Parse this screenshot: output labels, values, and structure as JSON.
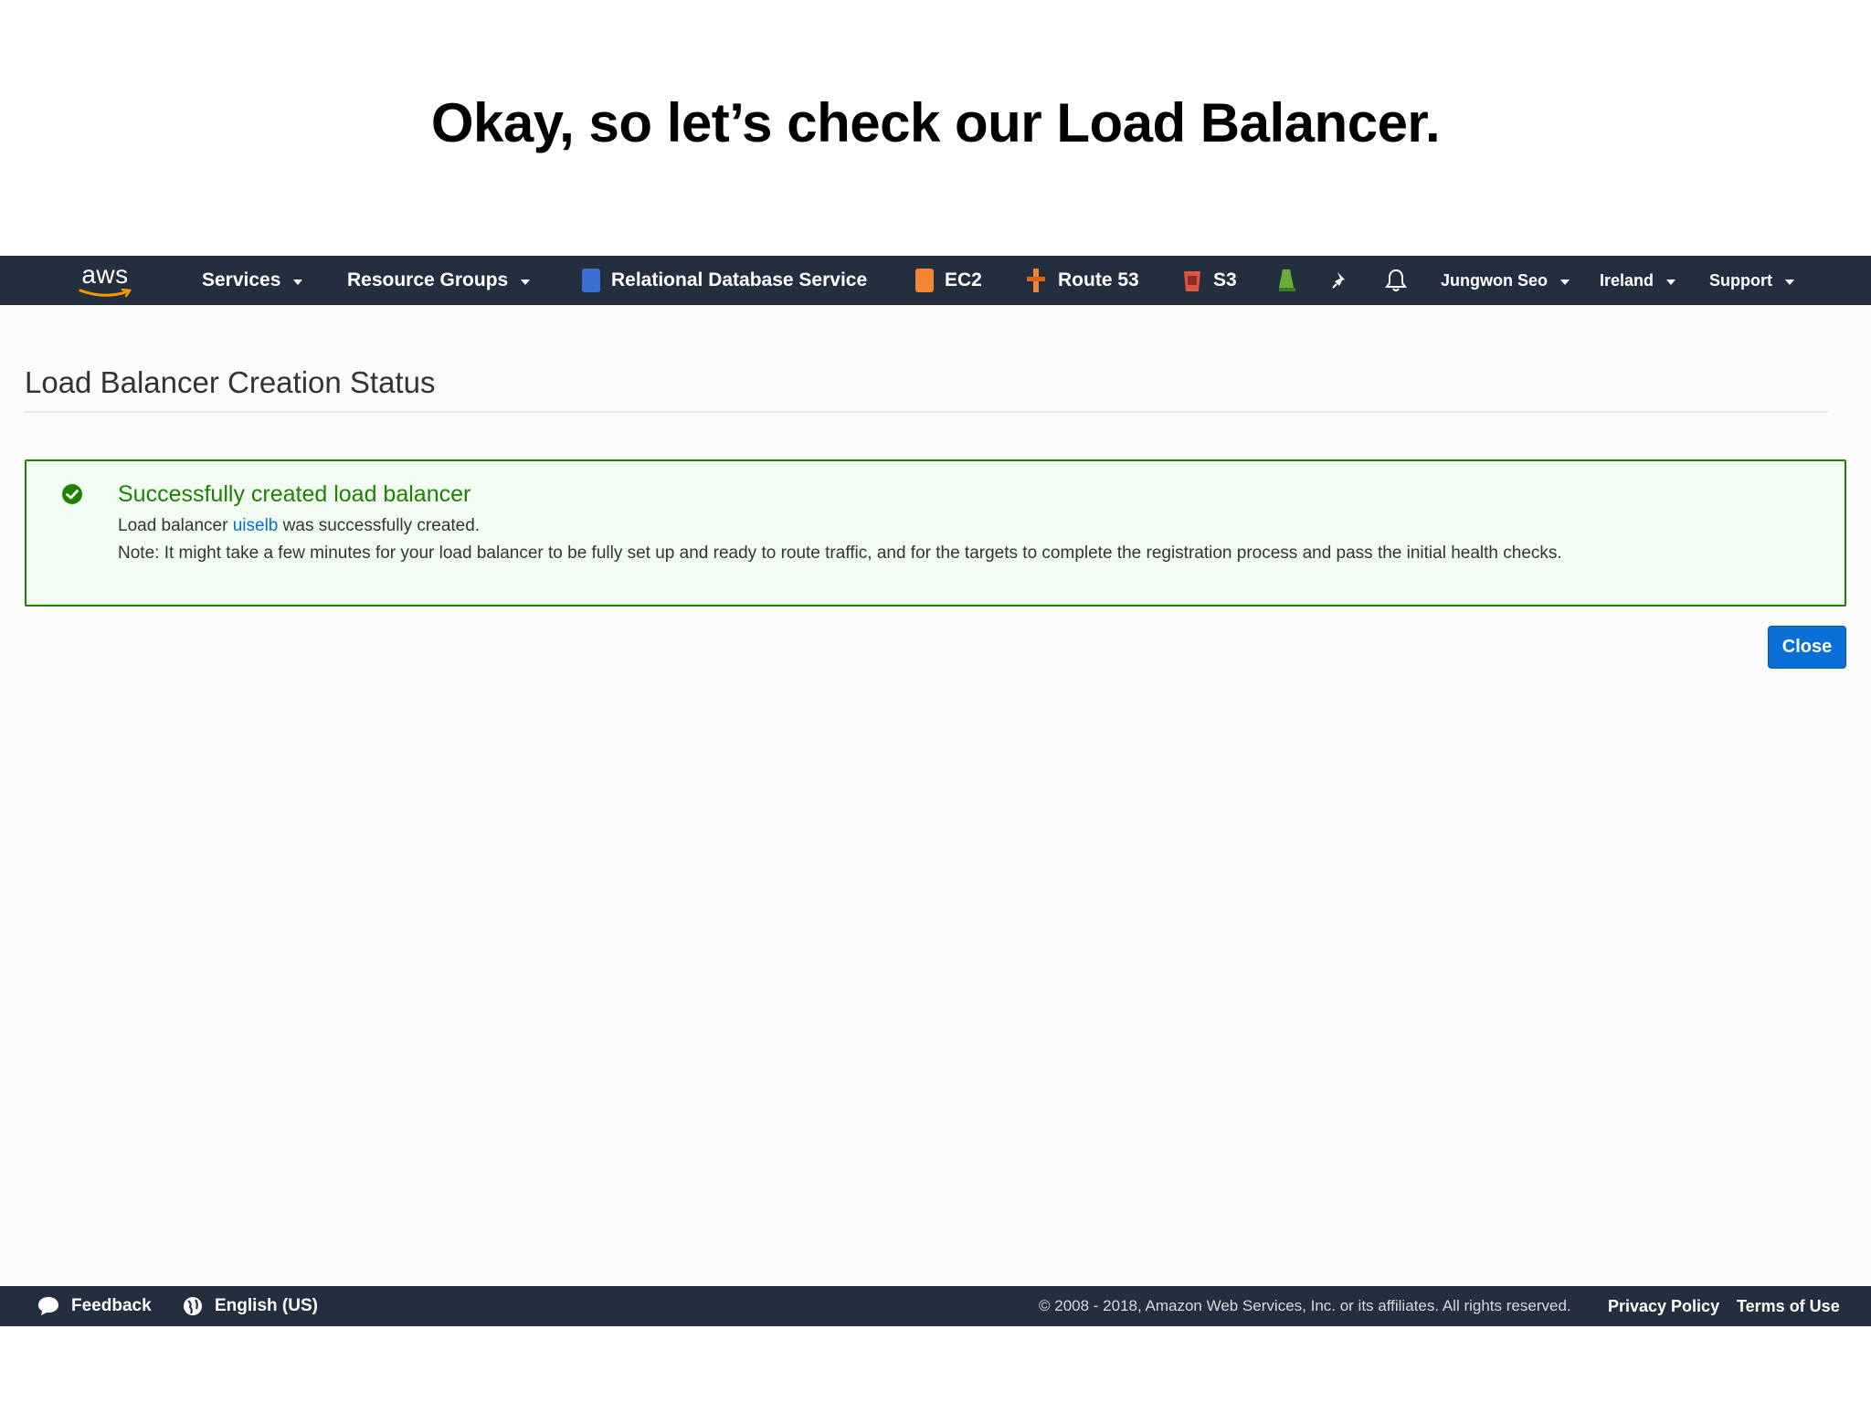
{
  "slide": {
    "title": "Okay, so let’s check our Load Balancer."
  },
  "topnav": {
    "logo_text": "aws",
    "services": "Services",
    "resource_groups": "Resource Groups",
    "shortcuts": [
      {
        "label": "Relational Database Service",
        "icon": "rds-icon",
        "color": "#3b6fd4"
      },
      {
        "label": "EC2",
        "icon": "ec2-icon",
        "color": "#f58536"
      },
      {
        "label": "Route 53",
        "icon": "route53-icon",
        "color": "#f58536"
      },
      {
        "label": "S3",
        "icon": "s3-icon",
        "color": "#e05243"
      }
    ],
    "user": "Jungwon Seo",
    "region": "Ireland",
    "support": "Support"
  },
  "page": {
    "heading": "Load Balancer Creation Status",
    "success": {
      "title": "Successfully created load balancer",
      "line1_prefix": "Load balancer",
      "link": "uiselb",
      "line1_suffix": "was successfully created.",
      "note": "Note: It might take a few minutes for your load balancer to be fully set up and ready to route traffic, and for the targets to complete the registration process and pass the initial health checks."
    },
    "close_button": "Close"
  },
  "footer": {
    "feedback": "Feedback",
    "language": "English (US)",
    "copyright": "© 2008 - 2018, Amazon Web Services, Inc. or its affiliates. All rights reserved.",
    "privacy": "Privacy Policy",
    "terms": "Terms of Use"
  },
  "colors": {
    "nav_bg": "#232f3e",
    "success_green": "#1d8102",
    "primary_blue": "#0a6fd6",
    "aws_orange": "#ff9900"
  }
}
